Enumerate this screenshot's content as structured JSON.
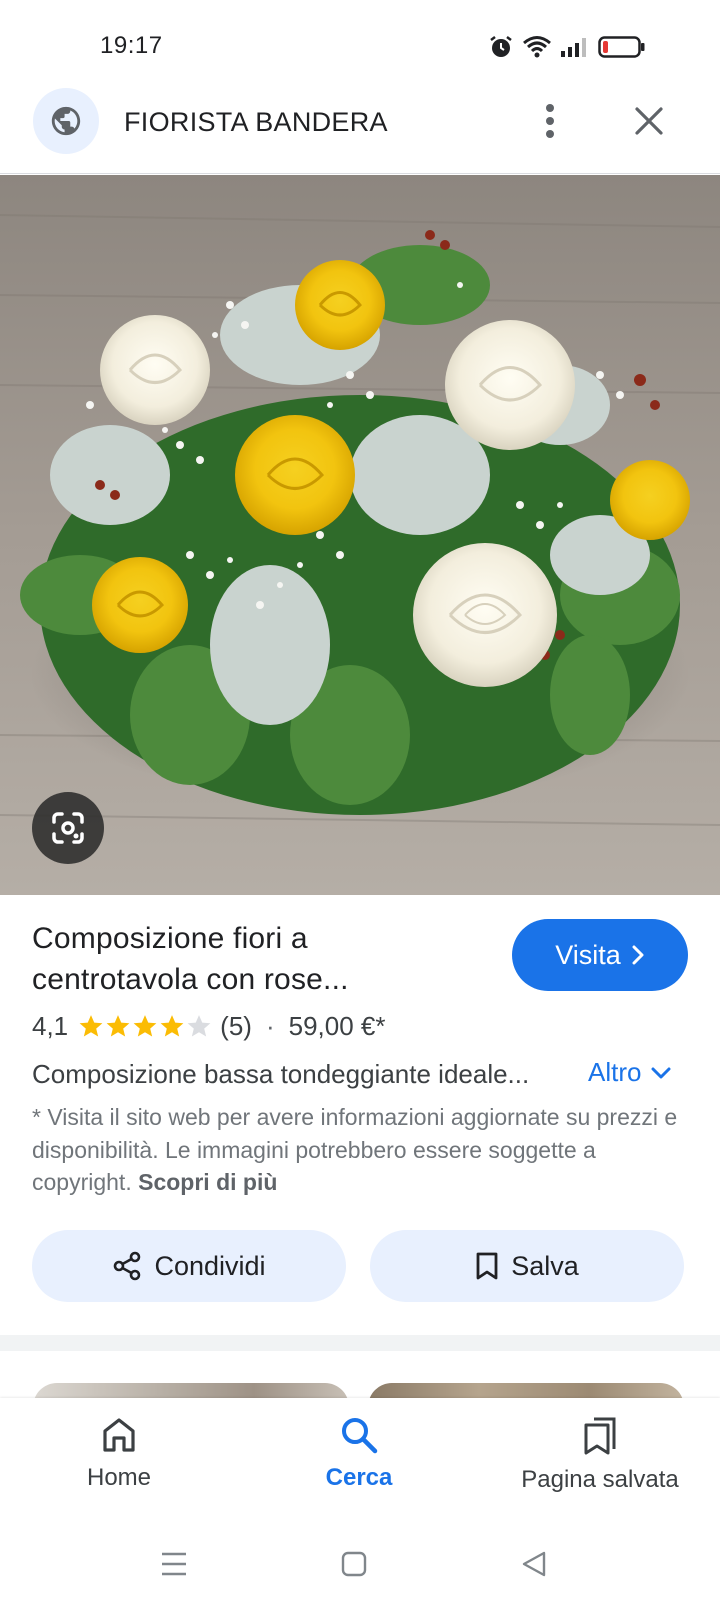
{
  "status_bar": {
    "time": "19:17",
    "icons": [
      "alarm-icon",
      "wifi-icon",
      "signal-icon",
      "battery-icon"
    ],
    "battery_color": "#e53935"
  },
  "header": {
    "site_name": "FIORISTA BANDERA",
    "icons": {
      "site": "globe-icon",
      "menu": "more-vert-icon",
      "close": "close-icon"
    }
  },
  "image": {
    "description_icon": "lens-icon"
  },
  "product": {
    "title_line1": "Composizione fiori a",
    "title_line2": "centrotavola con rose...",
    "visit_label": "Visita",
    "rating": "4,1",
    "rating_value": 4.1,
    "stars_total": 5,
    "review_count": "(5)",
    "separator": "·",
    "price": "59,00 €*",
    "description": "Composizione bassa tondeggiante ideale...",
    "more_label": "Altro",
    "disclaimer": "* Visita il sito web per avere informazioni aggiornate su prezzi e disponibilità. Le immagini potrebbero essere soggette a copyright.",
    "learn_more": "Scopri di più"
  },
  "actions": {
    "share_label": "Condividi",
    "save_label": "Salva"
  },
  "bottom_nav": {
    "items": [
      {
        "label": "Home",
        "icon": "home-icon",
        "active": false
      },
      {
        "label": "Cerca",
        "icon": "search-icon",
        "active": true
      },
      {
        "label": "Pagina salvata",
        "icon": "bookmarks-icon",
        "active": false
      }
    ]
  },
  "system_nav": {
    "icons": [
      "recents-icon",
      "home-square-icon",
      "back-triangle-icon"
    ]
  },
  "colors": {
    "accent": "#1a73e8",
    "chip_bg": "#e8f0fe",
    "star": "#fbbc04",
    "text": "#202124",
    "muted": "#70757a"
  }
}
